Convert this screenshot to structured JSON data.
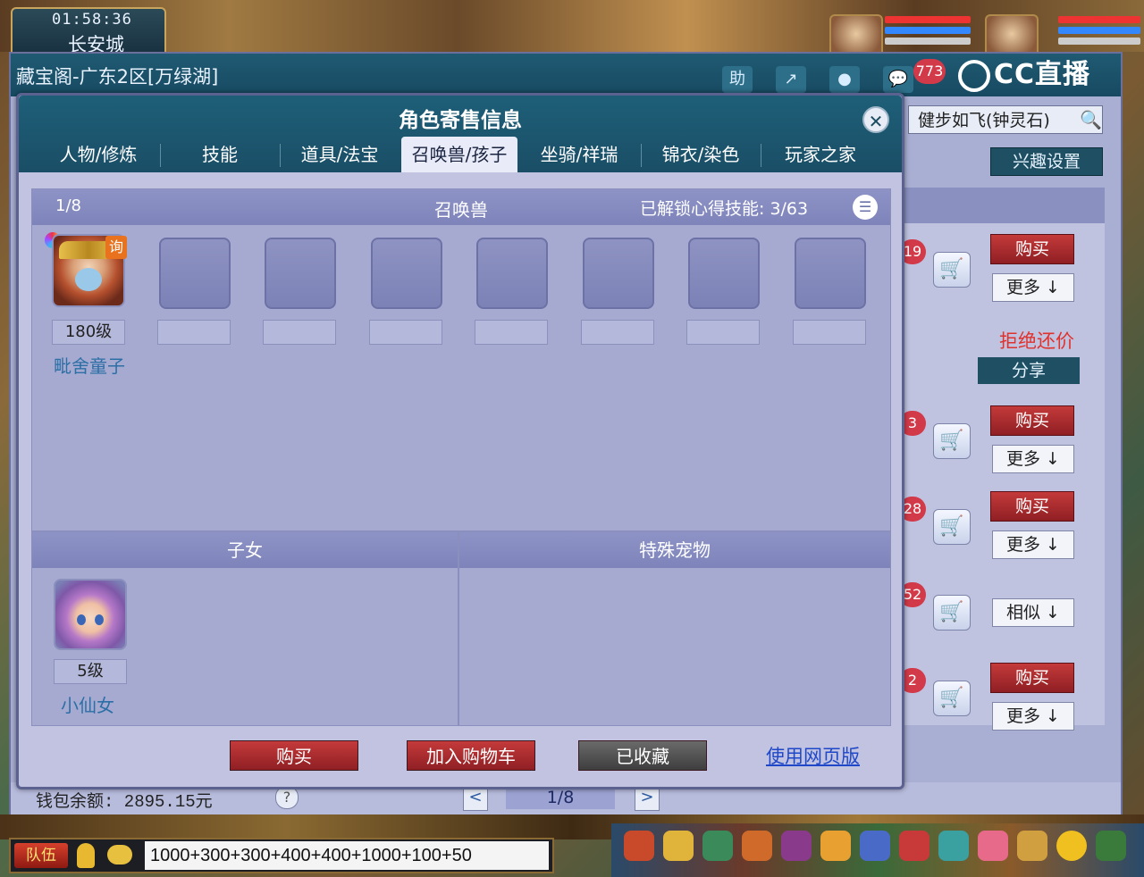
{
  "hud": {
    "time": "01:58:36",
    "city": "长安城"
  },
  "main": {
    "title": "藏宝阁-广东2区[万绿湖]",
    "help_label": "助",
    "notification_count": "773",
    "logo_text": "CC直播",
    "search_value": "健步如飞(钟灵石)",
    "interest_label": "兴趣设置",
    "refuse_text": "拒绝还价",
    "share_label": "分享",
    "rows": [
      {
        "badge": "19",
        "buy": "购买",
        "more": "更多 ↓"
      },
      {
        "badge": "3",
        "buy": "购买",
        "more": "更多 ↓"
      },
      {
        "badge": "28",
        "buy": "购买",
        "more": "更多 ↓"
      },
      {
        "badge": "52",
        "buy": "",
        "more": "相似 ↓"
      },
      {
        "badge": "2",
        "buy": "购买",
        "more": "更多 ↓"
      }
    ],
    "wallet": "钱包余额: 2895.15元",
    "help_q": "?",
    "page": "1/8",
    "prev": "<",
    "next": ">"
  },
  "dialog": {
    "title": "角色寄售信息",
    "close": "✕",
    "tabs": [
      "人物/修炼",
      "技能",
      "道具/法宝",
      "召唤兽/孩子",
      "坐骑/祥瑞",
      "锦衣/染色",
      "玩家之家"
    ],
    "active_tab": 3,
    "pet_panel": {
      "page": "1/8",
      "title": "召唤兽",
      "skills": "已解锁心得技能: 3/63",
      "pet": {
        "level": "180级",
        "name": "毗舍童子",
        "ask_badge": "询"
      }
    },
    "child_panel": {
      "title": "子女",
      "child": {
        "level": "5级",
        "name": "小仙女"
      }
    },
    "special_panel": {
      "title": "特殊宠物"
    },
    "buttons": {
      "buy": "购买",
      "add_cart": "加入购物车",
      "favorited": "已收藏",
      "web": "使用网页版"
    }
  },
  "chat": {
    "team": "队伍",
    "input": "1000+300+300+400+400+1000+100+50"
  }
}
